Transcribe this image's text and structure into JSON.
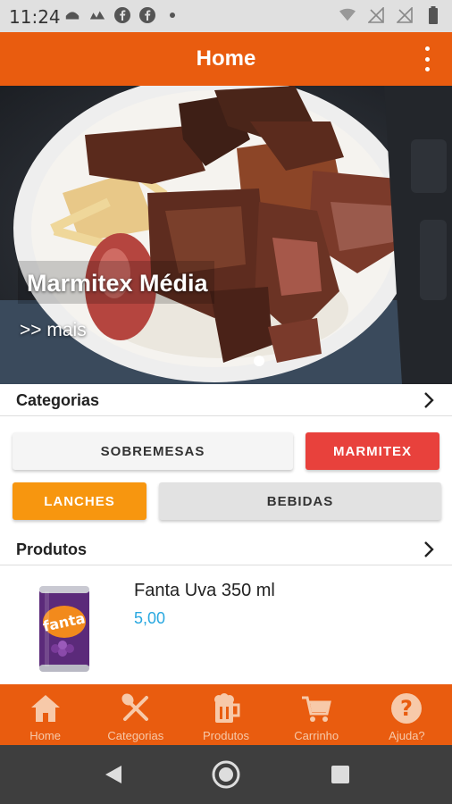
{
  "status_bar": {
    "time": "11:24",
    "left_icons": [
      "app-notification-icon",
      "app-notification-icon",
      "facebook-icon",
      "facebook-icon",
      "dot-icon"
    ],
    "right_icons": [
      "wifi-icon",
      "no-signal-icon",
      "no-signal-icon",
      "battery-icon"
    ]
  },
  "app_bar": {
    "title": "Home",
    "menu_icon": "more-vert-icon"
  },
  "banner": {
    "title": "Marmitex Média",
    "more_label": ">> mais",
    "active_page": 1
  },
  "categories": {
    "header": "Categorias",
    "chips": [
      {
        "label": "SOBREMESAS",
        "style": "light",
        "bg": "#f5f5f5",
        "fg": "#333333"
      },
      {
        "label": "MARMITEX",
        "style": "red",
        "bg": "#e8413c",
        "fg": "#ffffff"
      },
      {
        "label": "LANCHES",
        "style": "orange",
        "bg": "#f7960f",
        "fg": "#ffffff"
      },
      {
        "label": "BEBIDAS",
        "style": "gray",
        "bg": "#e2e2e2",
        "fg": "#333333"
      }
    ]
  },
  "products": {
    "header": "Produtos",
    "items": [
      {
        "name": "Fanta Uva 350 ml",
        "price": "5,00",
        "image": "fanta-grape-can"
      }
    ]
  },
  "bottom_nav": {
    "items": [
      {
        "label": "Home",
        "icon": "home-icon"
      },
      {
        "label": "Categorias",
        "icon": "cutlery-icon"
      },
      {
        "label": "Produtos",
        "icon": "beer-mug-icon"
      },
      {
        "label": "Carrinho",
        "icon": "cart-icon"
      },
      {
        "label": "Ajuda?",
        "icon": "help-icon"
      }
    ]
  },
  "colors": {
    "primary": "#e95c0f",
    "price": "#29a8e0",
    "nav_label": "#f7c9a9"
  }
}
